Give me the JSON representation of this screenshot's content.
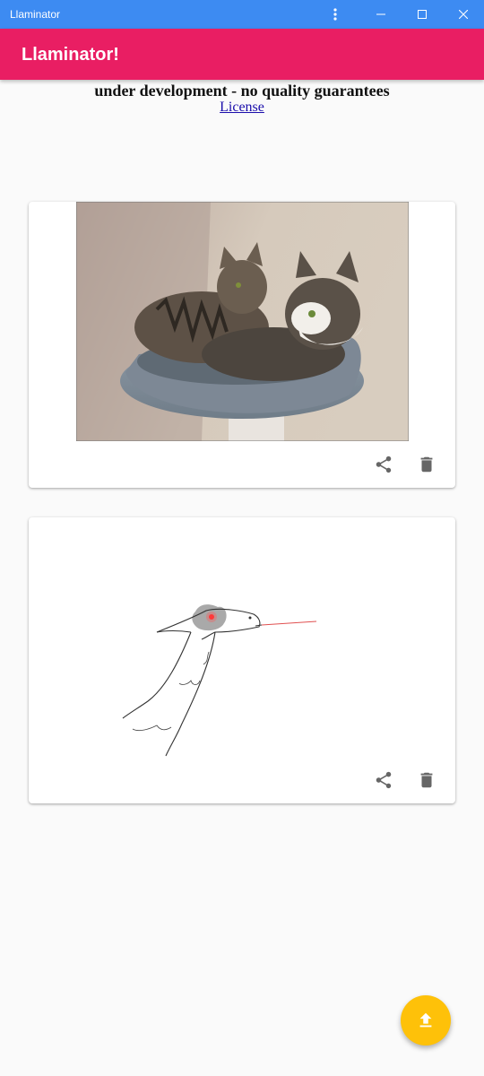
{
  "window": {
    "title": "Llaminator",
    "menu_icon": "more-vert-icon",
    "minimize_icon": "minimize-icon",
    "maximize_icon": "maximize-icon",
    "close_icon": "close-icon"
  },
  "appbar": {
    "title": "Llaminator!",
    "color": "#e91e63"
  },
  "notice": {
    "text": "under development - no quality guarantees",
    "license_link": "License"
  },
  "cards": [
    {
      "image": "cats-in-cat-bed-photo",
      "share_icon": "share-icon",
      "delete_icon": "delete-icon"
    },
    {
      "image": "llama-sketch-drawing",
      "share_icon": "share-icon",
      "delete_icon": "delete-icon"
    }
  ],
  "fab": {
    "icon": "upload-icon",
    "color": "#fec109"
  }
}
